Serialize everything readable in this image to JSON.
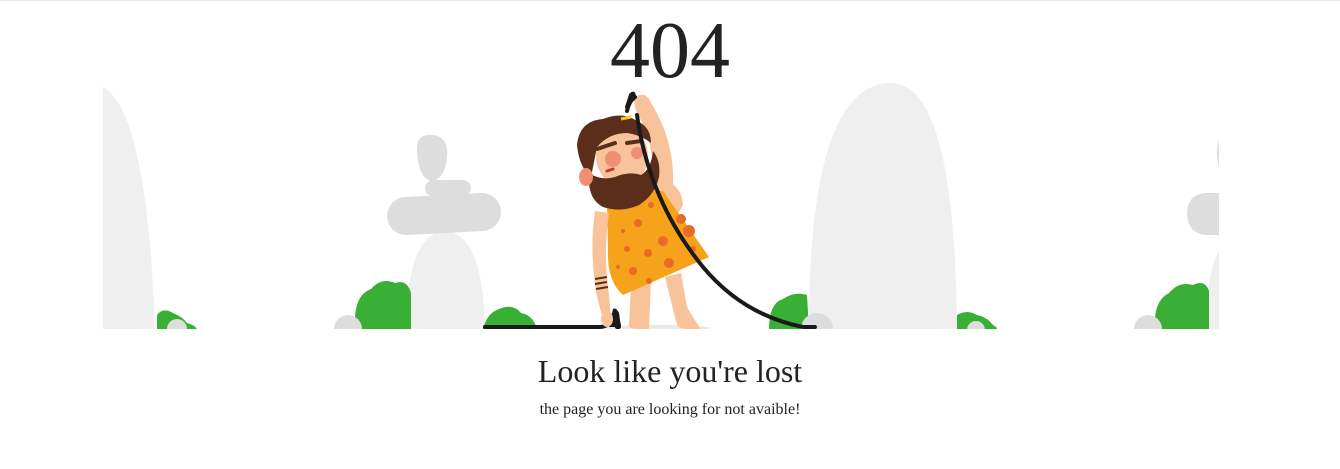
{
  "error": {
    "code": "404",
    "heading": "Look like you're lost",
    "message": "the page you are looking for not avaible!"
  },
  "illustration": {
    "icon": "caveman-pulling-cable-icon",
    "colors": {
      "rock": "#efefef",
      "stone": "#dddddd",
      "bush": "#3aaf35",
      "skin": "#f8c39b",
      "beard": "#5a2e1a",
      "tunic": "#f7a21b",
      "tunic_spots": "#ea6a26",
      "cable": "#1a1a1a"
    }
  }
}
